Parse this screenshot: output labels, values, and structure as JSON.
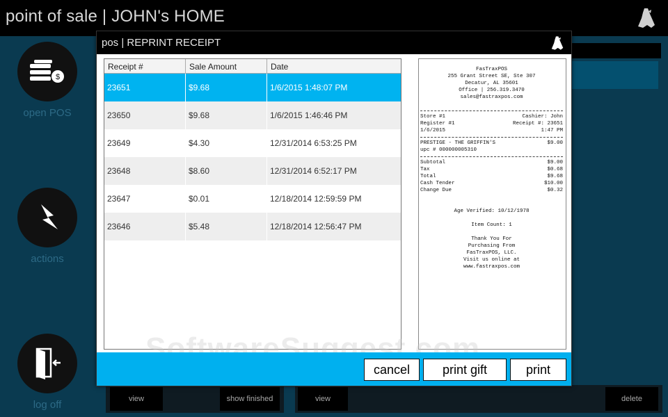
{
  "app": {
    "title": "point of sale | JOHN's HOME"
  },
  "nav": {
    "open_pos": "open POS",
    "actions": "actions",
    "log_off": "log off"
  },
  "background_buttons": {
    "view_left": "view",
    "show_finished": "show finished",
    "view_right": "view",
    "delete": "delete"
  },
  "modal": {
    "title": "pos | REPRINT RECEIPT",
    "columns": [
      "Receipt #",
      "Sale Amount",
      "Date"
    ],
    "rows": [
      {
        "receipt": "23651",
        "amount": "$9.68",
        "date": "1/6/2015 1:48:07 PM",
        "selected": true
      },
      {
        "receipt": "23650",
        "amount": "$9.68",
        "date": "1/6/2015 1:46:46 PM"
      },
      {
        "receipt": "23649",
        "amount": "$4.30",
        "date": "12/31/2014 6:53:25 PM"
      },
      {
        "receipt": "23648",
        "amount": "$8.60",
        "date": "12/31/2014 6:52:17 PM"
      },
      {
        "receipt": "23647",
        "amount": "$0.01",
        "date": "12/18/2014 12:59:59 PM"
      },
      {
        "receipt": "23646",
        "amount": "$5.48",
        "date": "12/18/2014 12:56:47 PM"
      }
    ],
    "buttons": {
      "cancel": "cancel",
      "print_gift": "print gift",
      "print": "print"
    }
  },
  "receipt": {
    "company": "FasTraxPOS",
    "address1": "255 Grant Street SE, Ste 307",
    "address2": "Decatur, AL 35601",
    "office": "Office | 256.319.3470",
    "email": "sales@fastraxpos.com",
    "store": "Store #1",
    "cashier": "Cashier: John",
    "register": "Register #1",
    "receipt_no": "Receipt #: 23651",
    "date": "1/6/2015",
    "time": "1:47 PM",
    "item_name": "PRESTIGE - THE GRIFFIN'S",
    "item_price": "$9.00",
    "item_upc": "upc # 000000005310",
    "totals": [
      {
        "label": "Subtotal",
        "value": "$9.00"
      },
      {
        "label": "Tax",
        "value": "$0.68"
      },
      {
        "label": "Total",
        "value": "$9.68"
      },
      {
        "label": "Cash Tender",
        "value": "$10.00"
      },
      {
        "label": "Change Due",
        "value": "$0.32"
      }
    ],
    "age_verified": "Age Verified: 10/12/1978",
    "item_count": "Item Count: 1",
    "thanks1": "Thank You For",
    "thanks2": "Purchasing From",
    "thanks3": "FasTraxPOS, LLC.",
    "visit": "Visit us online at",
    "website": "www.fastraxpos.com"
  },
  "watermark": "SoftwareSuggest.com",
  "colors": {
    "accent": "#00b3f0",
    "header": "#000000",
    "background": "#0a3a50"
  }
}
